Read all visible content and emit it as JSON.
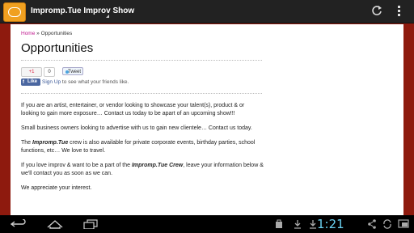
{
  "app": {
    "title": "Impromp.Tue Improv Show"
  },
  "breadcrumb": {
    "home": "Home",
    "separator": "»",
    "current": "Opportunities"
  },
  "page": {
    "title": "Opportunities"
  },
  "social": {
    "gplus_label": "+1",
    "gplus_count": "0",
    "tweet_label": "Tweet",
    "fb_like_label": "Like",
    "fb_signup": "Sign Up",
    "fb_text": " to see what your friends like."
  },
  "body": {
    "p1": "If you are an artist, entertainer, or vendor looking to showcase your talent(s), product & or looking to gain more exposure… Contact us today to be apart of an upcoming show!!!",
    "p2": "Small business owners looking to advertise with us to gain new clientele… Contact us today.",
    "p3_pre": "The ",
    "p3_brand": "Impromp.Tue",
    "p3_post": " crew is also available for private corporate events, birthday parties, school functions, etc… We love to travel.",
    "p4_pre": "If you love improv & want to be a part of the ",
    "p4_brand": "Impromp.Tue Crew",
    "p4_post": ", leave your information below & we'll contact you as soon as we can.",
    "p5": "We appreciate your interest."
  },
  "status": {
    "time": "1:21"
  },
  "colors": {
    "accent": "#c0178f",
    "background": "#8e1a0e",
    "clock": "#6ad0f0"
  },
  "icons": [
    "app-logo-icon",
    "refresh-icon",
    "overflow-menu-icon",
    "back-icon",
    "home-icon",
    "recent-apps-icon",
    "download-icon",
    "share-icon",
    "screen-rotation-icon"
  ]
}
